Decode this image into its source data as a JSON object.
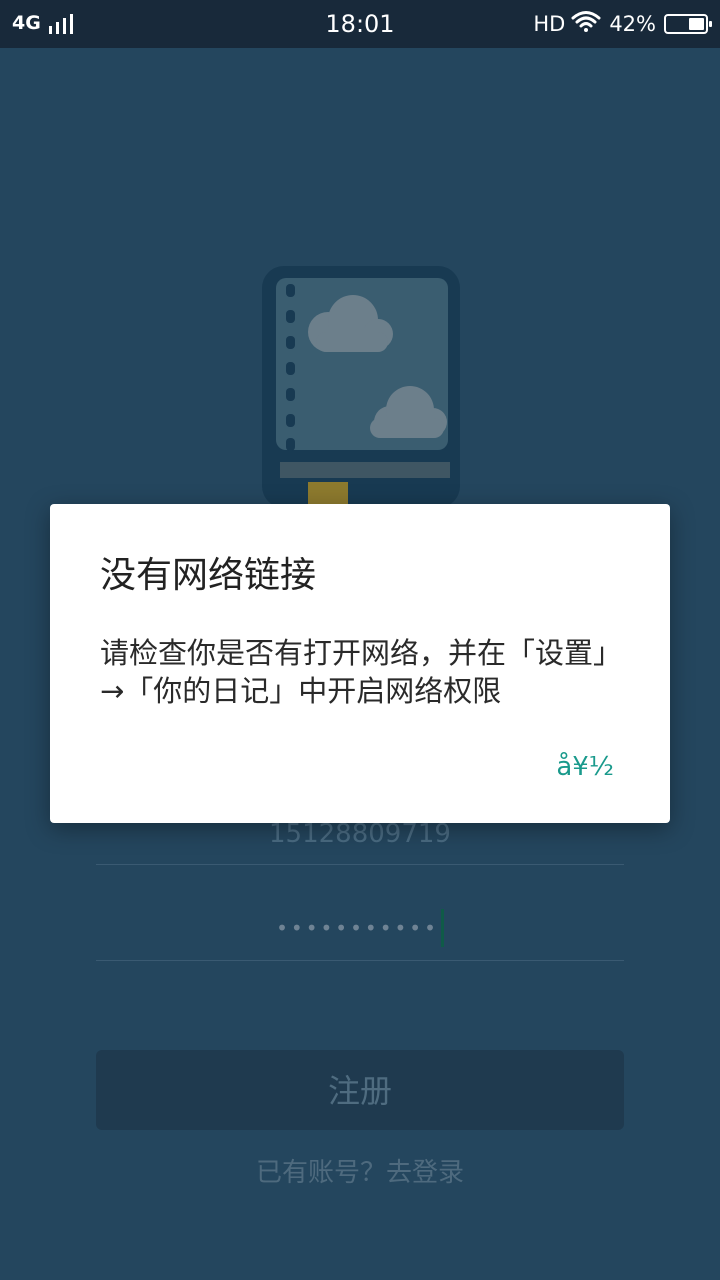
{
  "status_bar": {
    "network": "4G",
    "time": "18:01",
    "hd": "HD",
    "battery": "42%",
    "battery_level": 0.42
  },
  "form": {
    "phone_value": "15128809719",
    "password_masked": "•••••••••••",
    "register_label": "注册",
    "login_link": "已有账号？去登录"
  },
  "dialog": {
    "title": "没有网络链接",
    "message": "请检查你是否有打开网络，并在「设置」→「你的日记」中开启网络权限",
    "button": "å¥½"
  },
  "colors": {
    "background": "#24465e",
    "status_bar": "#18293a",
    "dialog_button": "#1a9a8c"
  }
}
